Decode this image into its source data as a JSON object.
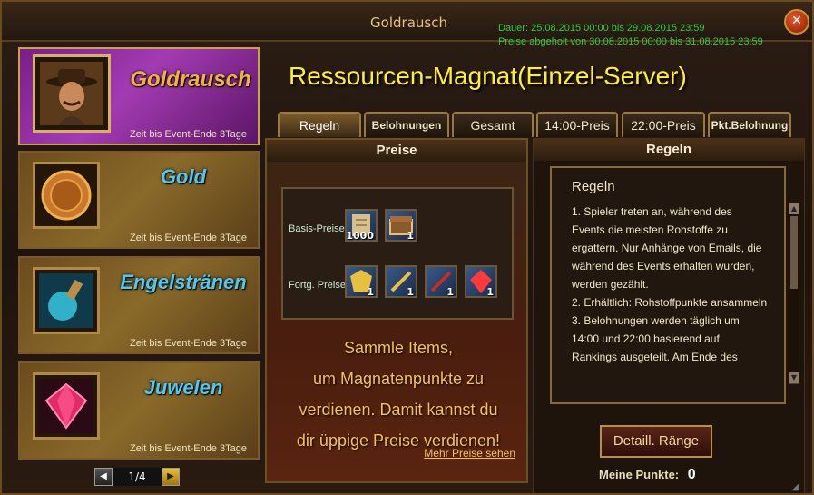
{
  "window": {
    "title": "Goldrausch",
    "duration": "Dauer: 25.08.2015 00:00 bis 29.08.2015 23:59",
    "claim": "Preise abgeholt von 30.08.2015 00:00 bis 31.08.2015 23:59",
    "close": "✕"
  },
  "events": [
    {
      "name": "Goldrausch",
      "time": "Zeit bis Event-Ende 3Tage",
      "icon": "adventurer-portrait-icon"
    },
    {
      "name": "Gold",
      "time": "Zeit bis Event-Ende 3Tage",
      "icon": "gold-coin-icon"
    },
    {
      "name": "Engelstränen",
      "time": "Zeit bis Event-Ende 3Tage",
      "icon": "potion-icon"
    },
    {
      "name": "Juwelen",
      "time": "Zeit bis Event-Ende 3Tage",
      "icon": "gem-icon"
    }
  ],
  "pager": {
    "prev": "◀",
    "page": "1/4",
    "next": "▶"
  },
  "main": {
    "title": "Ressourcen-Magnat(Einzel-Server)",
    "tabs": [
      "Regeln",
      "Belohnungen",
      "Gesamt",
      "14:00-Preis",
      "22:00-Preis",
      "Pkt.Belohnung"
    ]
  },
  "prizes": {
    "header": "Preise",
    "basic_label": "Basis-Preise",
    "advanced_label": "Fortg. Preise",
    "basic_items": [
      {
        "icon": "scroll-icon",
        "count": "1000"
      },
      {
        "icon": "chest-icon",
        "count": "1"
      }
    ],
    "advanced_items": [
      {
        "icon": "armor-icon",
        "count": "1"
      },
      {
        "icon": "sword-icon",
        "count": "1"
      },
      {
        "icon": "dagger-icon",
        "count": "1"
      },
      {
        "icon": "ruby-icon",
        "count": "1"
      }
    ],
    "promo_lines": [
      "Sammle Items,",
      "um Magnatenpunkte zu",
      "verdienen. Damit kannst du",
      "dir üppige Preise verdienen!"
    ],
    "more_link": "Mehr Preise sehen"
  },
  "rules": {
    "header": "Regeln",
    "title": "Regeln",
    "lines": [
      "1. Spieler treten an, während des Events die meisten Rohstoffe zu ergattern. Nur Anhänge von Emails, die während des Events erhalten wurden, werden gezählt.",
      "2. Erhältlich: Rohstoffpunkte ansammeln",
      "3. Belohnungen werden täglich um 14:00 und 22:00 basierend auf Rankings ausgeteilt. Am Ende des"
    ],
    "detail_button": "Detaill. Ränge",
    "points_label": "Meine Punkte:",
    "points_value": "0"
  },
  "colors": {
    "accent_green": "#2ecc40",
    "title_yellow": "#ffef2e",
    "active_purple": "#a33bb3"
  }
}
